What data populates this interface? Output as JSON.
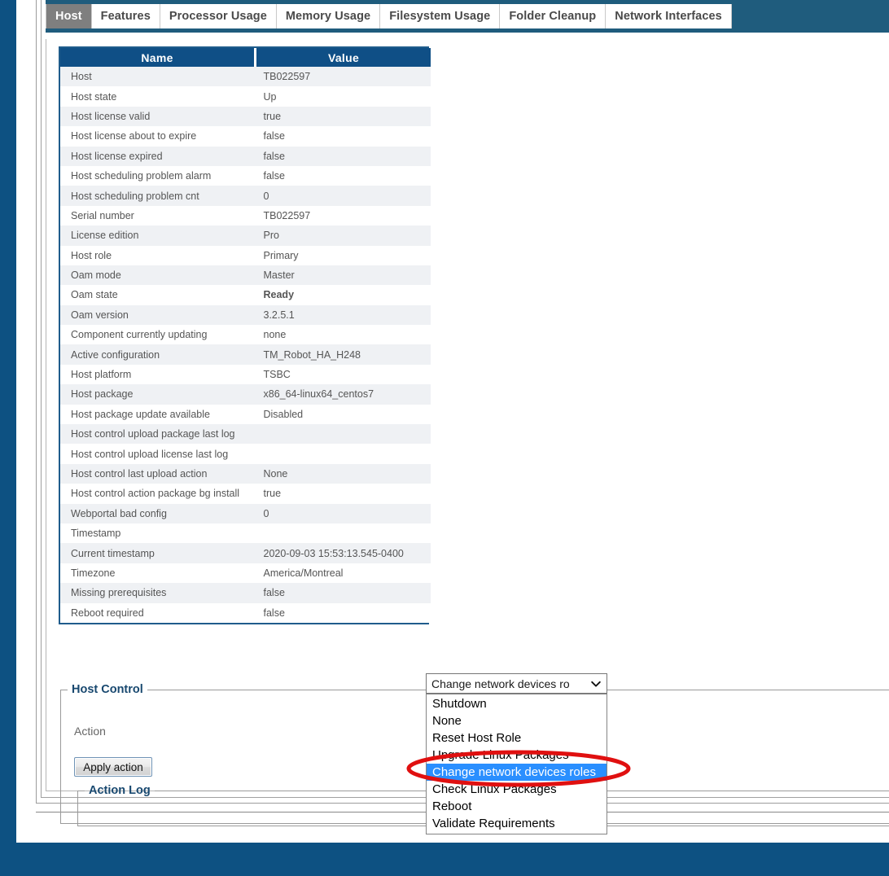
{
  "tabs": [
    {
      "label": "Host",
      "selected": true
    },
    {
      "label": "Features",
      "selected": false
    },
    {
      "label": "Processor Usage",
      "selected": false
    },
    {
      "label": "Memory Usage",
      "selected": false
    },
    {
      "label": "Filesystem Usage",
      "selected": false
    },
    {
      "label": "Folder Cleanup",
      "selected": false
    },
    {
      "label": "Network Interfaces",
      "selected": false
    }
  ],
  "table": {
    "headers": {
      "name": "Name",
      "value": "Value"
    },
    "rows": [
      {
        "name": "Host",
        "value": "TB022597"
      },
      {
        "name": "Host state",
        "value": "Up"
      },
      {
        "name": "Host license valid",
        "value": "true"
      },
      {
        "name": "Host license about to expire",
        "value": "false"
      },
      {
        "name": "Host license expired",
        "value": "false"
      },
      {
        "name": "Host scheduling problem alarm",
        "value": "false"
      },
      {
        "name": "Host scheduling problem cnt",
        "value": "0"
      },
      {
        "name": "Serial number",
        "value": "TB022597"
      },
      {
        "name": "License edition",
        "value": "Pro"
      },
      {
        "name": "Host role",
        "value": "Primary"
      },
      {
        "name": "Oam mode",
        "value": "Master"
      },
      {
        "name": "Oam state",
        "value": "Ready",
        "style": "ready"
      },
      {
        "name": "Oam version",
        "value": "3.2.5.1"
      },
      {
        "name": "Component currently updating",
        "value": "none"
      },
      {
        "name": "Active configuration",
        "value": "TM_Robot_HA_H248"
      },
      {
        "name": "Host platform",
        "value": "TSBC"
      },
      {
        "name": "Host package",
        "value": "x86_64-linux64_centos7"
      },
      {
        "name": "Host package update available",
        "value": "Disabled"
      },
      {
        "name": "Host control upload package last log",
        "value": ""
      },
      {
        "name": "Host control upload license last log",
        "value": ""
      },
      {
        "name": "Host control last upload action",
        "value": "None"
      },
      {
        "name": "Host control action package bg install",
        "value": "true"
      },
      {
        "name": "Webportal bad config",
        "value": "0"
      },
      {
        "name": "Timestamp",
        "value": ""
      },
      {
        "name": "Current timestamp",
        "value": "2020-09-03 15:53:13.545-0400"
      },
      {
        "name": "Timezone",
        "value": "America/Montreal"
      },
      {
        "name": "Missing prerequisites",
        "value": "false"
      },
      {
        "name": "Reboot required",
        "value": "false"
      }
    ]
  },
  "host_control": {
    "legend": "Host Control",
    "action_label": "Action",
    "apply_button": "Apply action",
    "action_log_legend": "Action Log",
    "action_log_text": ""
  },
  "action_select": {
    "selected_display": "Change network devices ro",
    "options": [
      {
        "label": "Shutdown",
        "selected": false
      },
      {
        "label": "None",
        "selected": false
      },
      {
        "label": "Reset Host Role",
        "selected": false
      },
      {
        "label": "Upgrade Linux Packages",
        "selected": false
      },
      {
        "label": "Change network devices roles",
        "selected": true
      },
      {
        "label": "Check Linux Packages",
        "selected": false
      },
      {
        "label": "Reboot",
        "selected": false
      },
      {
        "label": "Validate Requirements",
        "selected": false
      }
    ]
  },
  "colors": {
    "page_frame": "#0d5182",
    "tabbar": "#1f5c7d",
    "tab_selected_bg": "#7f7f7f",
    "table_header_bg": "#0f4f86",
    "table_border": "#1f5c8c",
    "row_alt_bg": "#eff1f4",
    "legend_text": "#18486f",
    "ready_green": "#0a7a18",
    "option_highlight": "#2a8fff",
    "annotation_red": "#e01010"
  }
}
